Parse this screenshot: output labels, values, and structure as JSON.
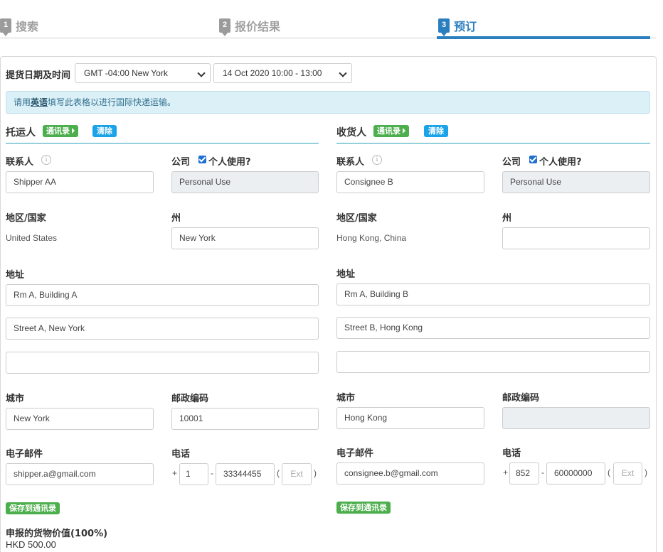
{
  "steps": [
    {
      "num": "1",
      "label": "搜索"
    },
    {
      "num": "2",
      "label": "报价结果"
    },
    {
      "num": "3",
      "label": "预订"
    }
  ],
  "pickup": {
    "label": "提货日期及时间",
    "timezone": "GMT -04:00 New York",
    "slot": "14 Oct 2020 10:00 - 13:00"
  },
  "notice": {
    "before": "请用",
    "emphasis": "英语",
    "after": "填写此表格以进行国际快递运输。"
  },
  "shipper": {
    "title": "托运人",
    "contacts_btn": "通讯录",
    "clear_btn": "清除",
    "contact_label": "联系人",
    "contact_value": "Shipper AA",
    "company_label": "公司",
    "personal_label": "个人使用?",
    "company_value": "Personal Use",
    "country_label": "地区/国家",
    "country_value": "United States",
    "state_label": "州",
    "state_value": "New York",
    "address_label": "地址",
    "address1": "Rm A, Building A",
    "address2": "Street A, New York",
    "address3": "",
    "city_label": "城市",
    "city_value": "New York",
    "postal_label": "邮政编码",
    "postal_value": "10001",
    "email_label": "电子邮件",
    "email_value": "shipper.a@gmail.com",
    "phone_label": "电话",
    "phone_plus": "+",
    "phone_country": "1",
    "phone_dash": "-",
    "phone_number": "33344455",
    "phone_paren_open": "(",
    "phone_ext_placeholder": "Ext",
    "phone_paren_close": ")",
    "save_btn": "保存到通讯录"
  },
  "consignee": {
    "title": "收货人",
    "contacts_btn": "通讯录",
    "clear_btn": "清除",
    "contact_label": "联系人",
    "contact_value": "Consignee B",
    "company_label": "公司",
    "personal_label": "个人使用?",
    "company_value": "Personal Use",
    "country_label": "地区/国家",
    "country_value": "Hong Kong, China",
    "state_label": "州",
    "state_value": "",
    "address_label": "地址",
    "address1": "Rm A, Building B",
    "address2": "Street B, Hong Kong",
    "address3": "",
    "city_label": "城市",
    "city_value": "Hong Kong",
    "postal_label": "邮政编码",
    "postal_value": "",
    "email_label": "电子邮件",
    "email_value": "consignee.b@gmail.com",
    "phone_label": "电话",
    "phone_plus": "+",
    "phone_country": "852",
    "phone_dash": "-",
    "phone_number": "60000000",
    "phone_paren_open": "(",
    "phone_ext_placeholder": "Ext",
    "phone_paren_close": ")",
    "save_btn": "保存到通讯录"
  },
  "declared": {
    "label": "申报的货物价值(100%)",
    "value": "HKD 500.00"
  },
  "colors": {
    "accent": "#2b7fbf",
    "green": "#4cae4c",
    "blue_button": "#1aa3e8",
    "section_line": "#2aa3b8"
  }
}
